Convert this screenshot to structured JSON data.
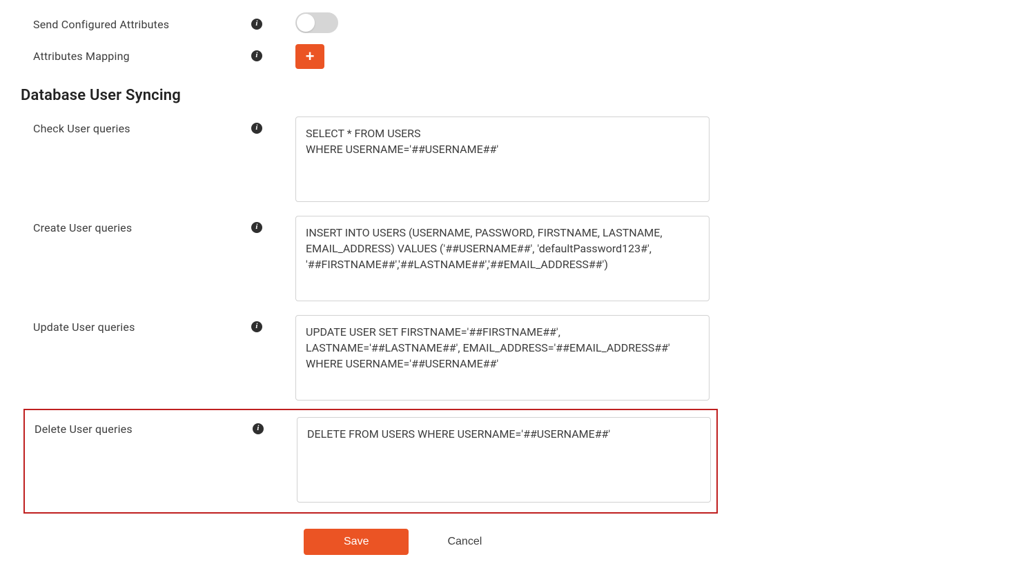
{
  "fields": {
    "send_configured_attributes": {
      "label": "Send Configured Attributes"
    },
    "attributes_mapping": {
      "label": "Attributes Mapping"
    },
    "section_title": "Database User Syncing",
    "check_user": {
      "label": "Check User queries",
      "value": "SELECT * FROM USERS\nWHERE USERNAME='##USERNAME##'"
    },
    "create_user": {
      "label": "Create User queries",
      "value": "INSERT INTO USERS (USERNAME, PASSWORD, FIRSTNAME, LASTNAME, EMAIL_ADDRESS) VALUES ('##USERNAME##', 'defaultPassword123#', '##FIRSTNAME##','##LASTNAME##','##EMAIL_ADDRESS##')"
    },
    "update_user": {
      "label": "Update User queries",
      "value": "UPDATE USER SET FIRSTNAME='##FIRSTNAME##', LASTNAME='##LASTNAME##', EMAIL_ADDRESS='##EMAIL_ADDRESS##' WHERE USERNAME='##USERNAME##'"
    },
    "delete_user": {
      "label": "Delete User queries",
      "value": "DELETE FROM USERS WHERE USERNAME='##USERNAME##'"
    }
  },
  "buttons": {
    "save": "Save",
    "cancel": "Cancel",
    "plus": "+"
  }
}
